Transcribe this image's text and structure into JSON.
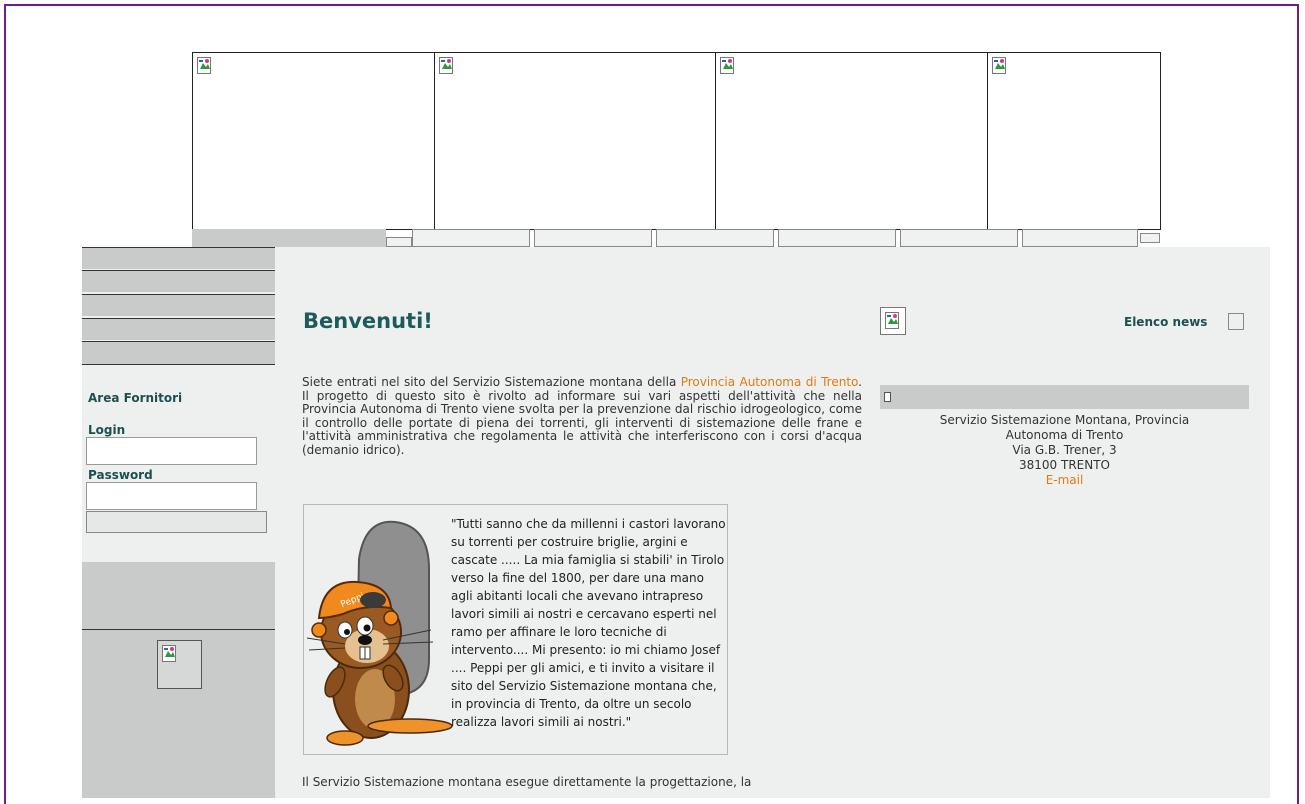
{
  "header": {
    "banner_images": [
      "broken-image",
      "broken-image",
      "broken-image",
      "broken-image"
    ],
    "tab_count": 6
  },
  "sidebar": {
    "area_title": "Area Fornitori",
    "login_label": "Login",
    "login_value": "",
    "password_label": "Password",
    "password_value": ""
  },
  "main": {
    "heading": "Benvenuti!",
    "intro_before_link": "Siete entrati nel sito del Servizio Sistemazione montana della ",
    "intro_link": "Provincia Autonoma di Trento",
    "intro_after_link": ". Il progetto di questo sito è rivolto ad informare sui vari aspetti dell'attività che nella Provincia Autonoma di Trento viene svolta per la prevenzione dal rischio idrogeologico, come il controllo delle portate di piena dei torrenti, gli interventi di sistemazione delle frane e l'attività amministrativa che regolamenta le attività che interferiscono con i corsi d'acqua (demanio idrico).",
    "quote": "\"Tutti sanno che da millenni i castori lavorano su torrenti per costruire briglie, argini e cascate ..... La mia famiglia si stabili' in Tirolo verso la fine del 1800, per dare una mano agli abitanti locali che avevano intrapreso lavori simili ai nostri e cercavano esperti nel ramo per affinare le loro tecniche di intervento.... Mi presento: io mi chiamo Josef .... Peppi per gli amici, e ti invito a visitare il sito del Servizio Sistemazione montana che, in provincia di Trento, da oltre un secolo realizza lavori simili ai nostri.\"",
    "helmet_text": "Peppi",
    "bottom_text": "Il Servizio Sistemazione montana esegue direttamente la progettazione, la"
  },
  "right": {
    "news_label": "Elenco news",
    "address_line1": "Servizio Sistemazione Montana, Provincia",
    "address_line2": "Autonoma di Trento",
    "address_line3": "Via G.B. Trener, 3",
    "address_line4": "38100 TRENTO",
    "email_link": "E-mail"
  },
  "colors": {
    "accent": "#e07a10",
    "heading": "#1d5a5a",
    "panel_bg": "#eef0f0",
    "bar_gray": "#c9caca",
    "frame": "#6b1f8f"
  }
}
